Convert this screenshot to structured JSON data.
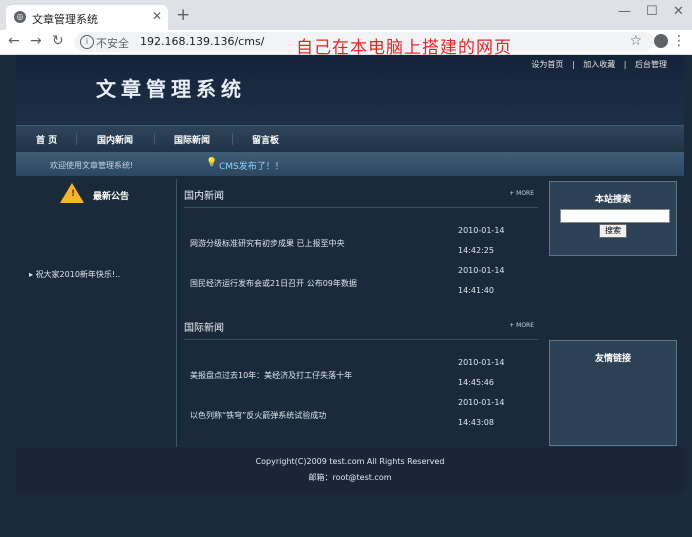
{
  "browser": {
    "tab_title": "文章管理系统",
    "insecure_label": "不安全",
    "url": "192.168.139.136/cms/",
    "annotation": "自己在本电脑上搭建的网页"
  },
  "site": {
    "logo": "文章管理系统",
    "top_links": [
      "设为首页",
      "|",
      "加入收藏",
      "|",
      "后台管理"
    ],
    "nav": [
      "首 页",
      "国内新闻",
      "国际新闻",
      "留言板"
    ],
    "welcome": "欢迎使用文章管理系统!",
    "announcement": "CMS发布了！！"
  },
  "notice": {
    "title": "最新公告",
    "item": "祝大家2010新年快乐!.."
  },
  "domestic": {
    "title": "国内新闻",
    "more": "+ MORE",
    "items": [
      {
        "title": "网游分级标准研究有初步成果 已上报至中央",
        "date": "2010-01-14",
        "time": "14:42:25"
      },
      {
        "title": "国民经济运行发布会或21日召开 公布09年数据",
        "date": "2010-01-14",
        "time": "14:41:40"
      }
    ]
  },
  "international": {
    "title": "国际新闻",
    "more": "+ MORE",
    "items": [
      {
        "title": "美报盘点过去10年：美经济及打工仔失落十年",
        "date": "2010-01-14",
        "time": "14:45:46"
      },
      {
        "title": "以色列称“铁穹”反火箭弹系统试验成功",
        "date": "2010-01-14",
        "time": "14:43:08"
      }
    ]
  },
  "search": {
    "title": "本站搜索",
    "value": "",
    "button": "搜索"
  },
  "links_panel": {
    "title": "友情链接"
  },
  "footer": {
    "copyright": "Copyright(C)2009 test.com All Rights Reserved",
    "email": "邮箱：root@test.com"
  },
  "colors": {
    "background": "#1b2a3a",
    "annotation": "#e5252a",
    "accent": "#8fd3ff"
  }
}
